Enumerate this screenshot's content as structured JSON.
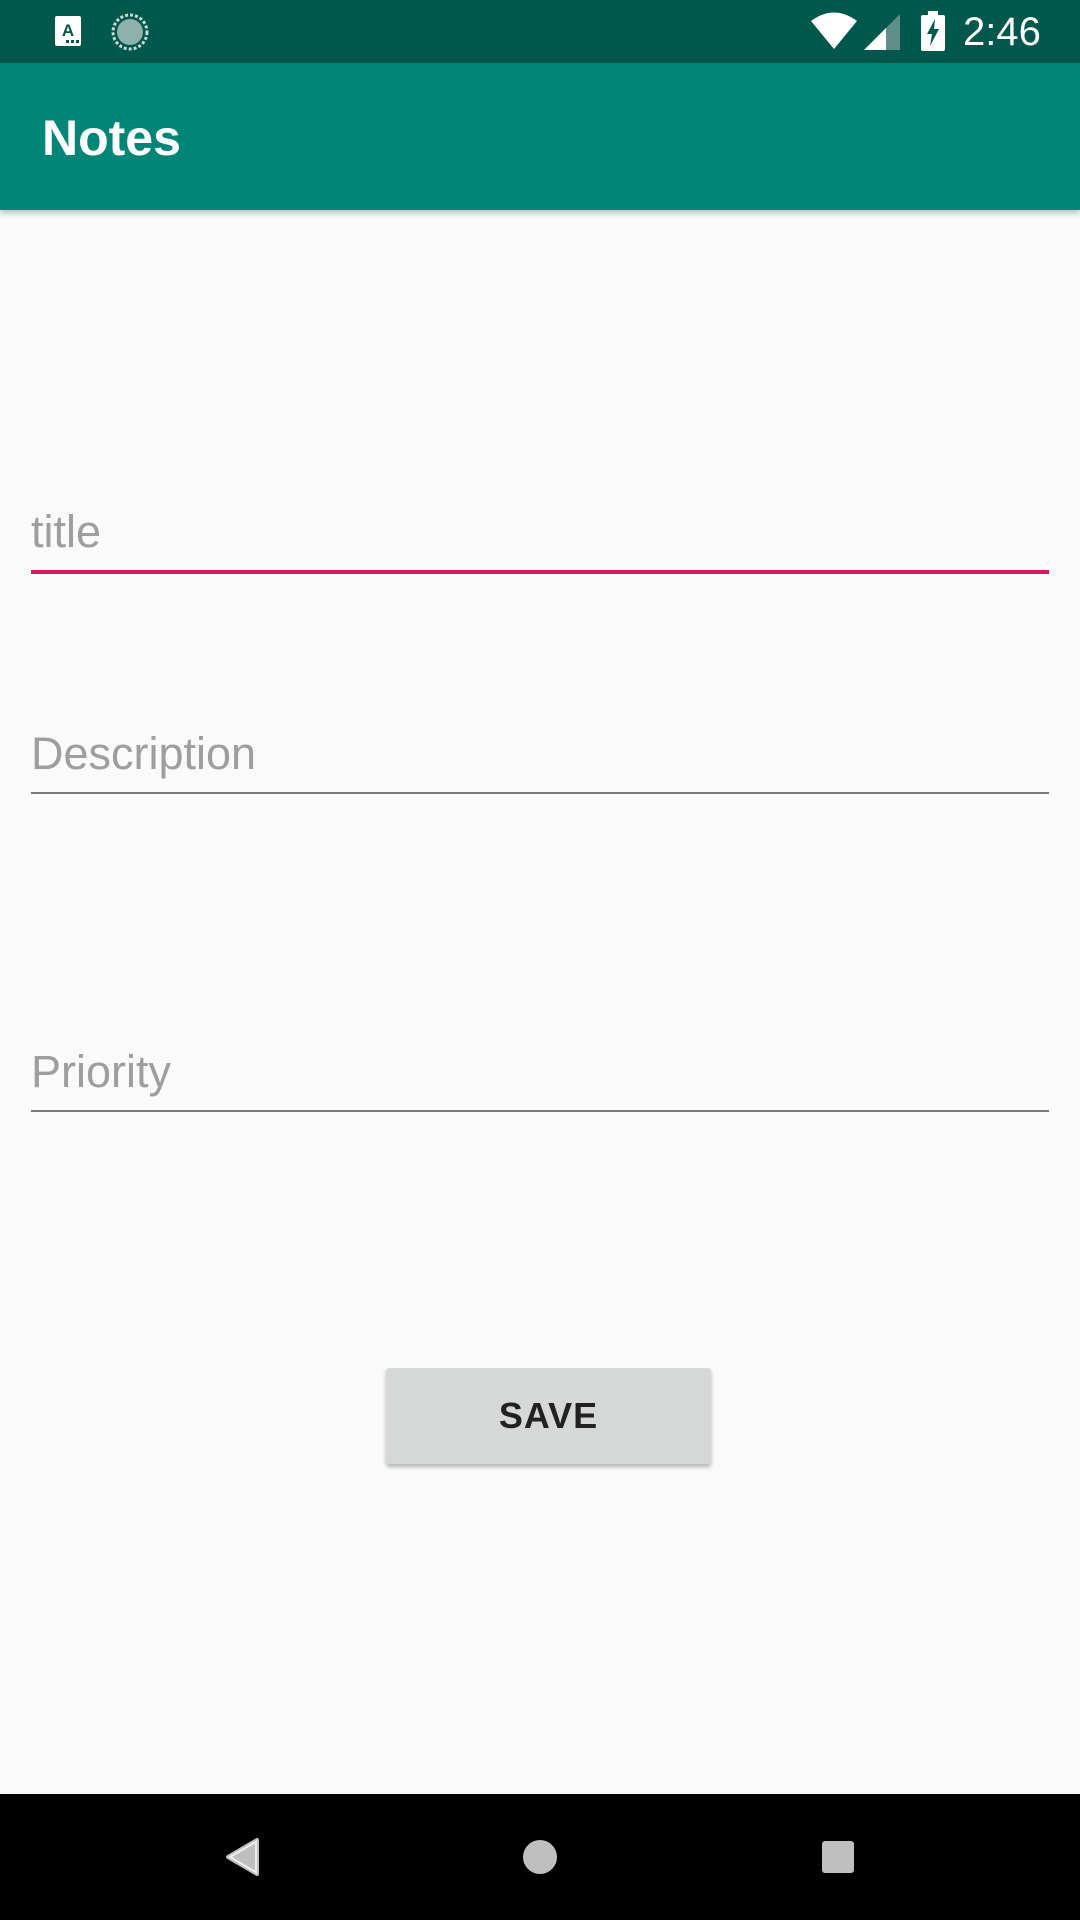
{
  "status_bar": {
    "time": "2:46",
    "notification_icons": [
      "a-box-icon",
      "spinner-icon"
    ],
    "system_icons": [
      "wifi-icon",
      "signal-icon",
      "battery-charging-icon"
    ]
  },
  "app_bar": {
    "title": "Notes"
  },
  "form": {
    "title_field": {
      "placeholder": "title",
      "value": ""
    },
    "description_field": {
      "placeholder": "Description",
      "value": ""
    },
    "priority_field": {
      "placeholder": "Priority",
      "value": ""
    },
    "save_label": "SAVE"
  },
  "nav_bar": {
    "buttons": [
      "back-icon",
      "home-icon",
      "recents-icon"
    ]
  },
  "colors": {
    "status_bar": "#00574b",
    "primary": "#008577",
    "accent": "#d81b60",
    "background": "#fafafa",
    "button": "#d6d7d7"
  }
}
